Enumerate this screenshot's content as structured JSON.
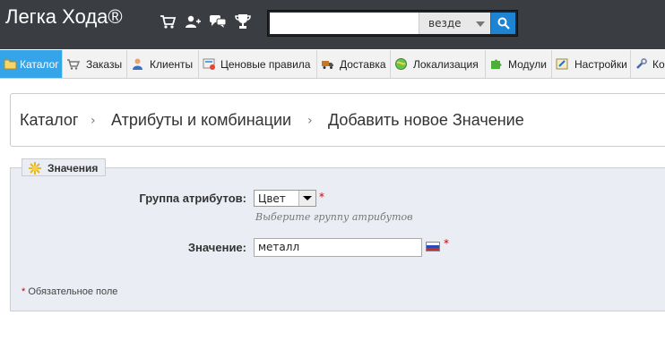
{
  "header": {
    "brand": "Легка Хода®",
    "icons": [
      "cart-icon",
      "user-add-icon",
      "chat-icon",
      "trophy-icon"
    ],
    "search": {
      "value": "",
      "placeholder": "",
      "scope_selected": "везде",
      "button_icon": "search-icon"
    }
  },
  "nav": {
    "tabs": [
      {
        "label": "Каталог",
        "icon": "folder-icon",
        "active": true
      },
      {
        "label": "Заказы",
        "icon": "cart-icon",
        "active": false
      },
      {
        "label": "Клиенты",
        "icon": "user-icon",
        "active": false
      },
      {
        "label": "Ценовые правила",
        "icon": "price-icon",
        "active": false
      },
      {
        "label": "Доставка",
        "icon": "truck-icon",
        "active": false
      },
      {
        "label": "Локализация",
        "icon": "globe-icon",
        "active": false
      },
      {
        "label": "Модули",
        "icon": "puzzle-icon",
        "active": false
      },
      {
        "label": "Настройки",
        "icon": "settings-icon",
        "active": false
      },
      {
        "label": "Ко",
        "icon": "wrench-icon",
        "active": false
      }
    ]
  },
  "breadcrumb": {
    "items": [
      "Каталог",
      "Атрибуты и комбинации",
      "Добавить новое Значение"
    ],
    "separator": "›"
  },
  "form": {
    "legend": "Значения",
    "attribute_group_label": "Группа атрибутов:",
    "attribute_group_value": "Цвет",
    "attribute_group_hint": "Выберите группу атрибутов",
    "value_label": "Значение:",
    "value_value": "металл",
    "required_mark": "*",
    "required_note": "Обязательное поле"
  },
  "colors": {
    "header_bg": "#3a3d42",
    "active_tab": "#36a4e8",
    "panel_bg": "#ebedf4",
    "required": "#cc0000"
  }
}
